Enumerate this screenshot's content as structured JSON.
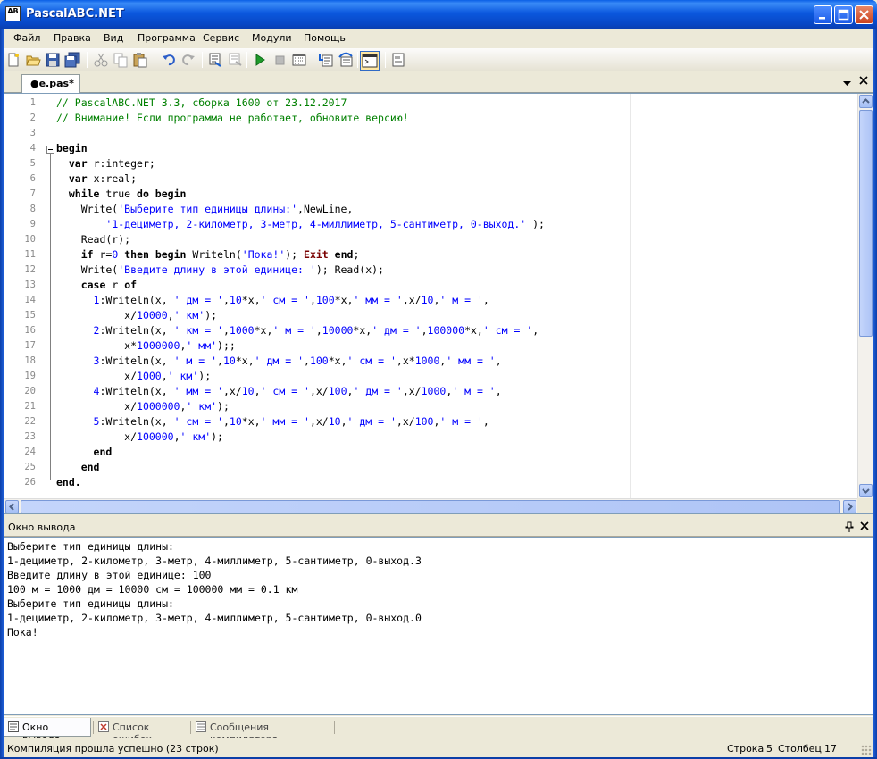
{
  "window": {
    "title": "PascalABC.NET",
    "app_icon_text": "AB"
  },
  "menu": [
    "Файл",
    "Правка",
    "Вид",
    "Программа",
    "Сервис",
    "Модули",
    "Помощь"
  ],
  "toolbar": {
    "icons": [
      "new-file-icon",
      "open-folder-icon",
      "save-icon",
      "save-all-icon",
      "cut-icon",
      "copy-icon",
      "paste-icon",
      "undo-icon",
      "redo-icon",
      "compile-icon",
      "compile-all-icon",
      "run-icon",
      "stop-icon",
      "debug-step-icon",
      "step-into-icon",
      "step-over-icon",
      "output-window-icon",
      "form-designer-icon"
    ]
  },
  "editor": {
    "tab_label": "●e.pas*",
    "line_numbers": [
      "1",
      "2",
      "3",
      "4",
      "5",
      "6",
      "7",
      "8",
      "9",
      "10",
      "11",
      "12",
      "13",
      "14",
      "15",
      "16",
      "17",
      "18",
      "19",
      "20",
      "21",
      "22",
      "23",
      "24",
      "25",
      "26"
    ],
    "code_lines": [
      [
        [
          "cm",
          "// PascalABC.NET 3.3, сборка 1600 от 23.12.2017"
        ]
      ],
      [
        [
          "cm",
          "// Внимание! Если программа не работает, обновите версию!"
        ]
      ],
      [],
      [
        [
          "kw",
          "begin"
        ]
      ],
      [
        [
          "",
          "  "
        ],
        [
          "kw",
          "var"
        ],
        [
          "",
          " r:integer;"
        ]
      ],
      [
        [
          "",
          "  "
        ],
        [
          "kw",
          "var"
        ],
        [
          "",
          " x:real;"
        ]
      ],
      [
        [
          "",
          "  "
        ],
        [
          "kw",
          "while"
        ],
        [
          "",
          " true "
        ],
        [
          "kw",
          "do begin"
        ]
      ],
      [
        [
          "",
          "    Write("
        ],
        [
          "str",
          "'Выберите тип единицы длины:'"
        ],
        [
          "",
          ",NewLine,"
        ]
      ],
      [
        [
          "",
          "        "
        ],
        [
          "str",
          "'1-дециметр, 2-километр, 3-метр, 4-миллиметр, 5-сантиметр, 0-выход.'"
        ],
        [
          "",
          " );"
        ]
      ],
      [
        [
          "",
          "    Read(r);"
        ]
      ],
      [
        [
          "",
          "    "
        ],
        [
          "kw",
          "if"
        ],
        [
          "",
          " r="
        ],
        [
          "num",
          "0"
        ],
        [
          "",
          " "
        ],
        [
          "kw",
          "then begin"
        ],
        [
          "",
          " Writeln("
        ],
        [
          "str",
          "'Пока!'"
        ],
        [
          "",
          "); "
        ],
        [
          "kwr",
          "Exit"
        ],
        [
          "",
          " "
        ],
        [
          "kw",
          "end"
        ],
        [
          "",
          ";"
        ]
      ],
      [
        [
          "",
          "    Write("
        ],
        [
          "str",
          "'Введите длину в этой единице: '"
        ],
        [
          "",
          "); Read(x);"
        ]
      ],
      [
        [
          "",
          "    "
        ],
        [
          "kw",
          "case"
        ],
        [
          "",
          " r "
        ],
        [
          "kw",
          "of"
        ]
      ],
      [
        [
          "",
          "      "
        ],
        [
          "num",
          "1"
        ],
        [
          "",
          ":Writeln(x, "
        ],
        [
          "str",
          "' дм = '"
        ],
        [
          "",
          ","
        ],
        [
          "num",
          "10"
        ],
        [
          "",
          "*x,"
        ],
        [
          "str",
          "' см = '"
        ],
        [
          "",
          ","
        ],
        [
          "num",
          "100"
        ],
        [
          "",
          "*x,"
        ],
        [
          "str",
          "' мм = '"
        ],
        [
          "",
          ",x/"
        ],
        [
          "num",
          "10"
        ],
        [
          "",
          ","
        ],
        [
          "str",
          "' м = '"
        ],
        [
          "",
          ","
        ]
      ],
      [
        [
          "",
          "           x/"
        ],
        [
          "num",
          "10000"
        ],
        [
          "",
          ","
        ],
        [
          "str",
          "' км'"
        ],
        [
          "",
          ");"
        ]
      ],
      [
        [
          "",
          "      "
        ],
        [
          "num",
          "2"
        ],
        [
          "",
          ":Writeln(x, "
        ],
        [
          "str",
          "' км = '"
        ],
        [
          "",
          ","
        ],
        [
          "num",
          "1000"
        ],
        [
          "",
          "*x,"
        ],
        [
          "str",
          "' м = '"
        ],
        [
          "",
          ","
        ],
        [
          "num",
          "10000"
        ],
        [
          "",
          "*x,"
        ],
        [
          "str",
          "' дм = '"
        ],
        [
          "",
          ","
        ],
        [
          "num",
          "100000"
        ],
        [
          "",
          "*x,"
        ],
        [
          "str",
          "' см = '"
        ],
        [
          "",
          ","
        ]
      ],
      [
        [
          "",
          "           x*"
        ],
        [
          "num",
          "1000000"
        ],
        [
          "",
          ","
        ],
        [
          "str",
          "' мм'"
        ],
        [
          "",
          ");;"
        ]
      ],
      [
        [
          "",
          "      "
        ],
        [
          "num",
          "3"
        ],
        [
          "",
          ":Writeln(x, "
        ],
        [
          "str",
          "' м = '"
        ],
        [
          "",
          ","
        ],
        [
          "num",
          "10"
        ],
        [
          "",
          "*x,"
        ],
        [
          "str",
          "' дм = '"
        ],
        [
          "",
          ","
        ],
        [
          "num",
          "100"
        ],
        [
          "",
          "*x,"
        ],
        [
          "str",
          "' см = '"
        ],
        [
          "",
          ",x*"
        ],
        [
          "num",
          "1000"
        ],
        [
          "",
          ","
        ],
        [
          "str",
          "' мм = '"
        ],
        [
          "",
          ","
        ]
      ],
      [
        [
          "",
          "           x/"
        ],
        [
          "num",
          "1000"
        ],
        [
          "",
          ","
        ],
        [
          "str",
          "' км'"
        ],
        [
          "",
          ");"
        ]
      ],
      [
        [
          "",
          "      "
        ],
        [
          "num",
          "4"
        ],
        [
          "",
          ":Writeln(x, "
        ],
        [
          "str",
          "' мм = '"
        ],
        [
          "",
          ",x/"
        ],
        [
          "num",
          "10"
        ],
        [
          "",
          ","
        ],
        [
          "str",
          "' см = '"
        ],
        [
          "",
          ",x/"
        ],
        [
          "num",
          "100"
        ],
        [
          "",
          ","
        ],
        [
          "str",
          "' дм = '"
        ],
        [
          "",
          ",x/"
        ],
        [
          "num",
          "1000"
        ],
        [
          "",
          ","
        ],
        [
          "str",
          "' м = '"
        ],
        [
          "",
          ","
        ]
      ],
      [
        [
          "",
          "           x/"
        ],
        [
          "num",
          "1000000"
        ],
        [
          "",
          ","
        ],
        [
          "str",
          "' км'"
        ],
        [
          "",
          ");"
        ]
      ],
      [
        [
          "",
          "      "
        ],
        [
          "num",
          "5"
        ],
        [
          "",
          ":Writeln(x, "
        ],
        [
          "str",
          "' см = '"
        ],
        [
          "",
          ","
        ],
        [
          "num",
          "10"
        ],
        [
          "",
          "*x,"
        ],
        [
          "str",
          "' мм = '"
        ],
        [
          "",
          ",x/"
        ],
        [
          "num",
          "10"
        ],
        [
          "",
          ","
        ],
        [
          "str",
          "' дм = '"
        ],
        [
          "",
          ",x/"
        ],
        [
          "num",
          "100"
        ],
        [
          "",
          ","
        ],
        [
          "str",
          "' м = '"
        ],
        [
          "",
          ","
        ]
      ],
      [
        [
          "",
          "           x/"
        ],
        [
          "num",
          "100000"
        ],
        [
          "",
          ","
        ],
        [
          "str",
          "' км'"
        ],
        [
          "",
          ");"
        ]
      ],
      [
        [
          "",
          "      "
        ],
        [
          "kw",
          "end"
        ]
      ],
      [
        [
          "",
          "    "
        ],
        [
          "kw",
          "end"
        ]
      ],
      [
        [
          "kw",
          "end."
        ]
      ]
    ]
  },
  "output_panel": {
    "title": "Окно вывода",
    "lines": [
      "Выберите тип единицы длины:",
      "1-дециметр, 2-километр, 3-метр, 4-миллиметр, 5-сантиметр, 0-выход.3",
      "Введите длину в этой единице: 100",
      "100 м = 1000 дм = 10000 см = 100000 мм = 0.1 км",
      "Выберите тип единицы длины:",
      "1-дециметр, 2-километр, 3-метр, 4-миллиметр, 5-сантиметр, 0-выход.0",
      "Пока!"
    ]
  },
  "bottom_tabs": [
    "Окно вывода",
    "Список ошибок",
    "Сообщения компилятора"
  ],
  "status": {
    "message": "Компиляция прошла успешно (23 строк)",
    "row_label": "Строка",
    "row_value": "5",
    "col_label": "Столбец",
    "col_value": "17"
  }
}
